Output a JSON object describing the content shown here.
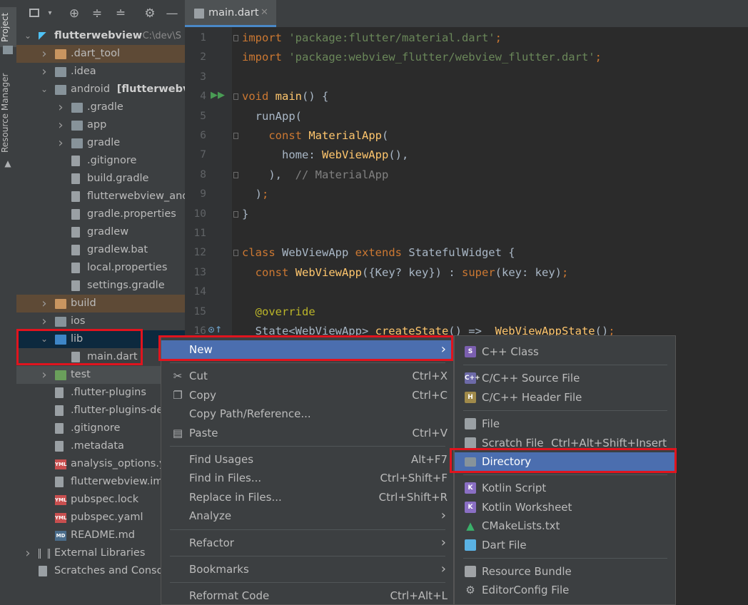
{
  "left_strip": {
    "project_tab": "Project",
    "resource_tab": "Resource Manager"
  },
  "project_tree": [
    {
      "label": "flutterwebview",
      "suffix": "C:\\dev\\S",
      "level": 0,
      "type": "root",
      "expanded": true
    },
    {
      "label": ".dart_tool",
      "level": 1,
      "type": "folder-orange",
      "expanded": false,
      "hl": "brown"
    },
    {
      "label": ".idea",
      "level": 1,
      "type": "folder",
      "expanded": false
    },
    {
      "label": "android",
      "suffix": "[flutterwebvie",
      "level": 1,
      "type": "folder",
      "expanded": true
    },
    {
      "label": ".gradle",
      "level": 2,
      "type": "folder",
      "expanded": false
    },
    {
      "label": "app",
      "level": 2,
      "type": "folder",
      "expanded": false
    },
    {
      "label": "gradle",
      "level": 2,
      "type": "folder",
      "expanded": false
    },
    {
      "label": ".gitignore",
      "level": 2,
      "type": "file"
    },
    {
      "label": "build.gradle",
      "level": 2,
      "type": "file"
    },
    {
      "label": "flutterwebview_andr",
      "level": 2,
      "type": "file"
    },
    {
      "label": "gradle.properties",
      "level": 2,
      "type": "file"
    },
    {
      "label": "gradlew",
      "level": 2,
      "type": "file"
    },
    {
      "label": "gradlew.bat",
      "level": 2,
      "type": "file"
    },
    {
      "label": "local.properties",
      "level": 2,
      "type": "file"
    },
    {
      "label": "settings.gradle",
      "level": 2,
      "type": "file"
    },
    {
      "label": "build",
      "level": 1,
      "type": "folder-orange",
      "expanded": false,
      "hl": "brown"
    },
    {
      "label": "ios",
      "level": 1,
      "type": "folder",
      "expanded": false
    },
    {
      "label": "lib",
      "level": 1,
      "type": "folder-blue",
      "expanded": true,
      "hl": "sel"
    },
    {
      "label": "main.dart",
      "level": 2,
      "type": "dart"
    },
    {
      "label": "test",
      "level": 1,
      "type": "folder-green",
      "expanded": false,
      "hl": "grey"
    },
    {
      "label": ".flutter-plugins",
      "level": 1,
      "type": "file"
    },
    {
      "label": ".flutter-plugins-de",
      "level": 1,
      "type": "file"
    },
    {
      "label": ".gitignore",
      "level": 1,
      "type": "file"
    },
    {
      "label": ".metadata",
      "level": 1,
      "type": "file"
    },
    {
      "label": "analysis_options.ya",
      "level": 1,
      "type": "yml"
    },
    {
      "label": "flutterwebview.iml",
      "level": 1,
      "type": "file"
    },
    {
      "label": "pubspec.lock",
      "level": 1,
      "type": "yml"
    },
    {
      "label": "pubspec.yaml",
      "level": 1,
      "type": "yml"
    },
    {
      "label": "README.md",
      "level": 1,
      "type": "md"
    },
    {
      "label": "External Libraries",
      "level": 0,
      "type": "libs",
      "expanded": false
    },
    {
      "label": "Scratches and Consol",
      "level": 0,
      "type": "scratch"
    }
  ],
  "editor": {
    "tab_title": "main.dart",
    "lines": [
      {
        "n": "1",
        "html": "<span class='kw'>import</span> <span class='str'>'package:flutter/material.dart'</span><span class='kw'>;</span>"
      },
      {
        "n": "2",
        "html": "<span class='kw'>import</span> <span class='str'>'package:webview_flutter/webview_flutter.dart'</span><span class='kw'>;</span>"
      },
      {
        "n": "3",
        "html": ""
      },
      {
        "n": "4",
        "html": "<span class='kw'>void</span> <span class='fn'>main</span>() {"
      },
      {
        "n": "5",
        "html": "  runApp("
      },
      {
        "n": "6",
        "html": "    <span class='kw'>const</span> <span class='fn'>MaterialApp</span>("
      },
      {
        "n": "7",
        "html": "      home: <span class='fn'>WebViewApp</span>(),"
      },
      {
        "n": "8",
        "html": "    ),  <span class='cm'>// MaterialApp</span>"
      },
      {
        "n": "9",
        "html": "  )<span class='kw'>;</span>"
      },
      {
        "n": "10",
        "html": "}"
      },
      {
        "n": "11",
        "html": ""
      },
      {
        "n": "12",
        "html": "<span class='kw'>class</span> WebViewApp <span class='kw'>extends</span> StatefulWidget {"
      },
      {
        "n": "13",
        "html": "  <span class='kw'>const</span> <span class='fn'>WebViewApp</span>({Key? key}) : <span class='kw'>super</span>(key: key)<span class='kw'>;</span>"
      },
      {
        "n": "14",
        "html": ""
      },
      {
        "n": "15",
        "html": "  <span class='ann'>@override</span>"
      },
      {
        "n": "16",
        "html": "  State&lt;WebViewApp&gt; <span class='fn'>createState</span>() =&gt; <span class='fn'>_WebViewAppState</span>()<span class='kw'>;</span>"
      }
    ]
  },
  "context_menu": [
    {
      "label": "New",
      "shortcut": "",
      "submenu": true,
      "selected": true
    },
    {
      "sep": true
    },
    {
      "label": "Cut",
      "shortcut": "Ctrl+X",
      "icon": "cut-icon"
    },
    {
      "label": "Copy",
      "shortcut": "Ctrl+C",
      "icon": "copy-icon"
    },
    {
      "label": "Copy Path/Reference...",
      "shortcut": ""
    },
    {
      "label": "Paste",
      "shortcut": "Ctrl+V",
      "icon": "paste-icon"
    },
    {
      "sep": true
    },
    {
      "label": "Find Usages",
      "shortcut": "Alt+F7"
    },
    {
      "label": "Find in Files...",
      "shortcut": "Ctrl+Shift+F"
    },
    {
      "label": "Replace in Files...",
      "shortcut": "Ctrl+Shift+R"
    },
    {
      "label": "Analyze",
      "shortcut": "",
      "submenu": true
    },
    {
      "sep": true
    },
    {
      "label": "Refactor",
      "shortcut": "",
      "submenu": true
    },
    {
      "sep": true
    },
    {
      "label": "Bookmarks",
      "shortcut": "",
      "submenu": true
    },
    {
      "sep": true
    },
    {
      "label": "Reformat Code",
      "shortcut": "Ctrl+Alt+L"
    }
  ],
  "new_submenu": [
    {
      "label": "C++ Class",
      "shortcut": "",
      "icon": "cpp-class-icon",
      "color": "#7b5fb0",
      "glyph": "S"
    },
    {
      "sep": true
    },
    {
      "label": "C/C++ Source File",
      "shortcut": "",
      "icon": "cpp-source-icon",
      "color": "#6d6aa8",
      "glyph": "C++"
    },
    {
      "label": "C/C++ Header File",
      "shortcut": "",
      "icon": "cpp-header-icon",
      "color": "#a08a4a",
      "glyph": "H"
    },
    {
      "sep": true
    },
    {
      "label": "File",
      "shortcut": "",
      "icon": "file-icon",
      "color": "#9aa0a4",
      "glyph": ""
    },
    {
      "label": "Scratch File",
      "shortcut": "Ctrl+Alt+Shift+Insert",
      "icon": "scratch-file-icon",
      "color": "#9aa0a4",
      "glyph": ""
    },
    {
      "label": "Directory",
      "shortcut": "",
      "icon": "directory-icon",
      "color": "#87939a",
      "glyph": "",
      "selected": true
    },
    {
      "sep": true
    },
    {
      "label": "Kotlin Script",
      "shortcut": "",
      "icon": "kotlin-script-icon",
      "color": "#8a6fc4",
      "glyph": "K"
    },
    {
      "label": "Kotlin Worksheet",
      "shortcut": "",
      "icon": "kotlin-worksheet-icon",
      "color": "#8a6fc4",
      "glyph": "K"
    },
    {
      "label": "CMakeLists.txt",
      "shortcut": "",
      "icon": "cmake-icon",
      "color": "#3a8fd0",
      "glyph": "▲"
    },
    {
      "label": "Dart File",
      "shortcut": "",
      "icon": "dart-file-icon",
      "color": "#5ab2e4",
      "glyph": ""
    },
    {
      "sep": true
    },
    {
      "label": "Resource Bundle",
      "shortcut": "",
      "icon": "resource-bundle-icon",
      "color": "#a0a3a6",
      "glyph": ""
    },
    {
      "label": "EditorConfig File",
      "shortcut": "",
      "icon": "editorconfig-icon",
      "color": "#a0a3a6",
      "glyph": "⚙"
    }
  ]
}
